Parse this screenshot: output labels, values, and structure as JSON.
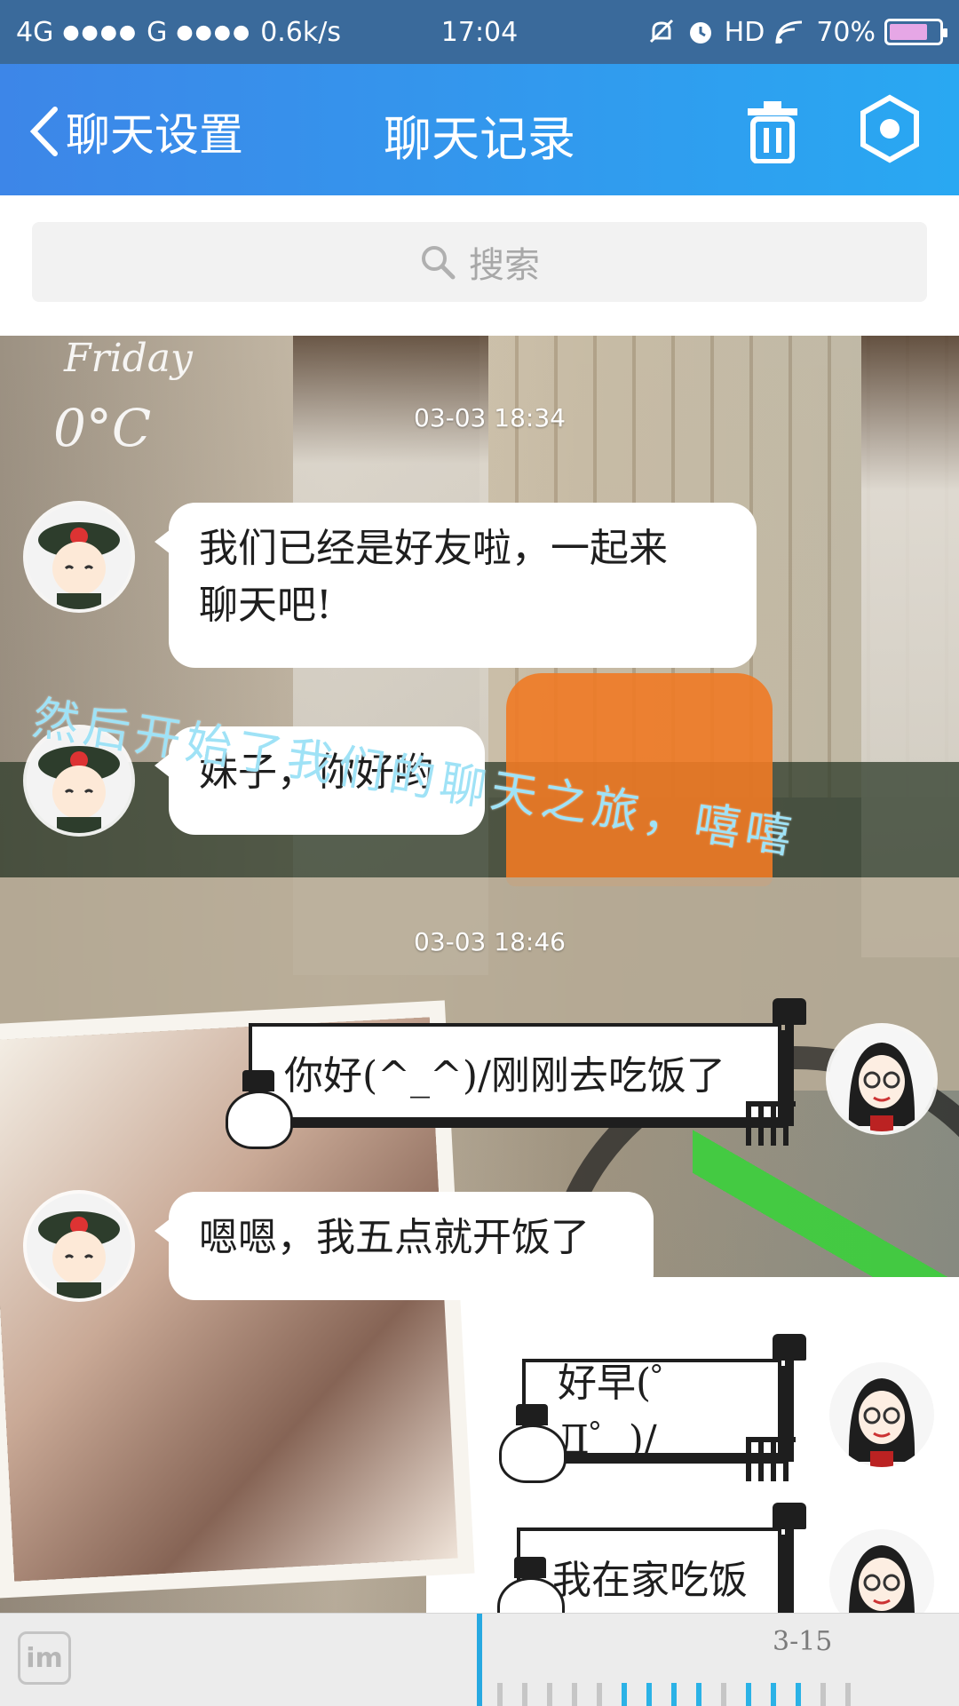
{
  "status_bar": {
    "network1": "4G",
    "network2": "G",
    "speed": "0.6k/s",
    "time": "17:04",
    "hd": "HD",
    "battery_percent": "70%",
    "battery_level": 0.7
  },
  "header": {
    "back_label": "聊天设置",
    "title": "聊天记录",
    "delete_icon": "trash-icon",
    "settings_icon": "hexagon-settings-icon",
    "background_colors": [
      "#3d86e8",
      "#29a8f2"
    ]
  },
  "search": {
    "placeholder": "搜索",
    "icon": "search-icon"
  },
  "background_text": {
    "day": "Friday",
    "temp": "0°C",
    "overlay": "然后开始了我们的聊天之旅，嘻嘻"
  },
  "messages": [
    {
      "type": "timestamp",
      "text": "03-03 18:34"
    },
    {
      "type": "incoming",
      "text_line1": "我们已经是好友啦，一起来",
      "text_line2": "聊天吧!"
    },
    {
      "type": "incoming",
      "text": "妹子，你好哟"
    },
    {
      "type": "timestamp",
      "text": "03-03 18:46"
    },
    {
      "type": "outgoing",
      "text": "你好(^_^)/刚刚去吃饭了"
    },
    {
      "type": "incoming",
      "text": "嗯嗯，我五点就开饭了"
    },
    {
      "type": "outgoing",
      "text": "好早(゜Д゜)/"
    },
    {
      "type": "outgoing",
      "text": "我在家吃饭"
    }
  ],
  "bottom_bar": {
    "im_label": "im",
    "date_label": "3-15"
  },
  "colors": {
    "accent_blue": "#27a9e1",
    "overlay_text": "#9fe2f6",
    "status_bar": "#3a6a9b"
  }
}
